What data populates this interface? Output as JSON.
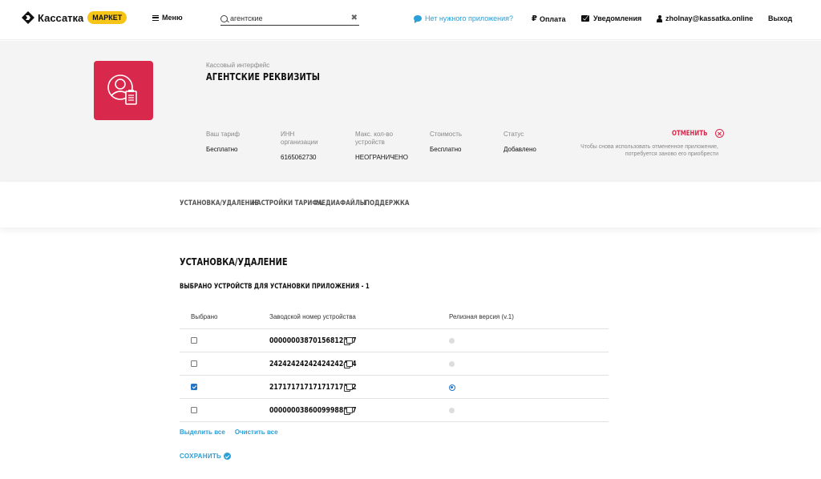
{
  "header": {
    "brand": "Кассатка",
    "brand_badge": "МАРКЕТ",
    "menu_label": "Меню",
    "search_value": "агентские",
    "clear_icon": "✖",
    "help_link": "Нет нужного приложения?",
    "payment_icon": "₽",
    "payment_link": "Оплата",
    "notifications_link": "Уведомления",
    "user_email": "zholnay@kassatka.online",
    "logout": "Выход"
  },
  "app": {
    "subtitle": "Кассовый интерфейс",
    "title": "АГЕНТСКИЕ РЕКВИЗИТЫ",
    "icon_color": "#d8294c",
    "info": [
      {
        "label": "Ваш тариф",
        "value": "Бесплатно"
      },
      {
        "label": "ИНН организации",
        "value": "6165062730"
      },
      {
        "label": "Макс. кол-во устройств",
        "value": "НЕОГРАНИЧЕНО"
      },
      {
        "label": "Стоимость",
        "value": "Бесплатно"
      },
      {
        "label": "Статус",
        "value": "Добавлено"
      }
    ],
    "cancel_label": "ОТМЕНИТЬ",
    "cancel_note": "Чтобы снова использовать отмененное приложение, потребуется заново его приобрести"
  },
  "tabs": [
    "УСТАНОВКА/УДАЛЕНИЕ",
    "НАСТРОЙКИ ТАРИФА",
    "МЕДИАФАЙЛЫ",
    "ПОДДЕРЖКА"
  ],
  "main": {
    "section_title": "УСТАНОВКА/УДАЛЕНИЕ",
    "selected_count": "ВЫБРАНО УСТРОЙСТВ ДЛЯ УСТАНОВКИ ПРИЛОЖЕНИЯ - 1",
    "columns": [
      "Выбрано",
      "Заводской номер устройства",
      "Релизная версия (v.1)"
    ],
    "rows": [
      {
        "serial": "00000003870156812277",
        "checked": false,
        "release": false
      },
      {
        "serial": "24242424242424242424",
        "checked": false,
        "release": false
      },
      {
        "serial": "21717171717171717172",
        "checked": true,
        "release": true
      },
      {
        "serial": "00000003860099988877",
        "checked": false,
        "release": false
      }
    ],
    "select_all": "Выделить все",
    "clear_all": "Очистить все",
    "save": "СОХРАНИТЬ"
  },
  "colors": {
    "accent": "#2a9fd8",
    "brand_badge": "#f5c518",
    "danger": "#d8294c",
    "checked": "#2374c6"
  }
}
